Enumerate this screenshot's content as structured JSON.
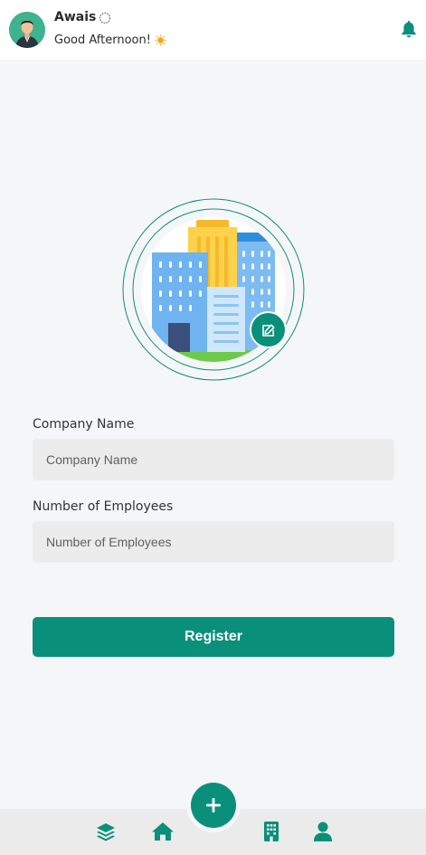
{
  "header": {
    "user_name": "Awais",
    "greeting": "Good Afternoon!",
    "icons": [
      "avatar",
      "loading-spinner-icon",
      "sun-icon",
      "bell-icon"
    ]
  },
  "form": {
    "company_name": {
      "label": "Company Name",
      "placeholder": "Company Name",
      "value": ""
    },
    "employees": {
      "label": "Number of Employees",
      "placeholder": "Number of Employees",
      "value": ""
    },
    "submit_label": "Register"
  },
  "logo": {
    "icons": [
      "buildings-icon",
      "edit-icon"
    ]
  },
  "bottom_nav": {
    "items": [
      "layers-icon",
      "home-icon",
      "plus-icon",
      "building-icon",
      "user-icon"
    ]
  },
  "colors": {
    "accent": "#0a8f7b",
    "input_bg": "#ececec",
    "page_bg": "#f5f6f8"
  }
}
